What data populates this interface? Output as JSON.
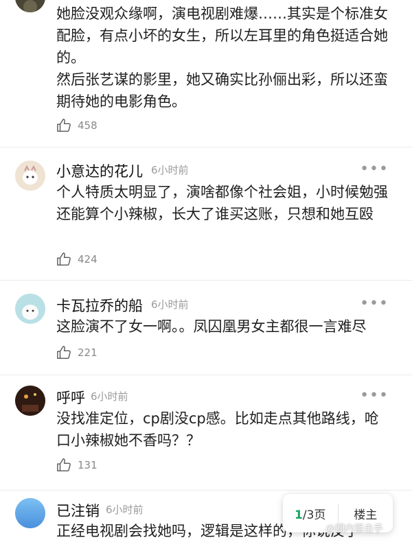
{
  "comments": [
    {
      "text_lines": [
        "她脸没观众缘啊，演电视剧难爆……其实是个标准女配脸，有点小坏的女生，所以左耳里的角色挺适合她的。",
        "然后张艺谋的影里，她又确实比孙俪出彩，所以还蛮期待她的电影角色。"
      ],
      "likes": "458"
    },
    {
      "name": "小意达的花儿",
      "time": "6小时前",
      "text": "个人特质太明显了，演啥都像个社会姐，小时候勉强还能算个小辣椒，长大了谁买这账，只想和她互殴",
      "likes": "424"
    },
    {
      "name": "卡瓦拉乔的船",
      "time": "6小时前",
      "text": "这脸演不了女一啊。。凤囚凰男女主都很一言难尽",
      "likes": "221"
    },
    {
      "name": "呼呼",
      "time": "6小时前",
      "text": "没找准定位，cp剧没cp感。比如走点其他路线，呛口小辣椒她不香吗？？",
      "likes": "131"
    },
    {
      "name": "已注销",
      "time": "6小时前",
      "text": "正经电视剧会找她吗，逻辑是这样的，你说反了"
    }
  ],
  "more_label": "•••",
  "pager": {
    "current": "1",
    "total_text": "/3页",
    "owner_label": "楼主"
  },
  "watermark": "@圈内狙击手",
  "colors": {
    "accent": "#1aa260",
    "meta": "#9a9a9a"
  }
}
